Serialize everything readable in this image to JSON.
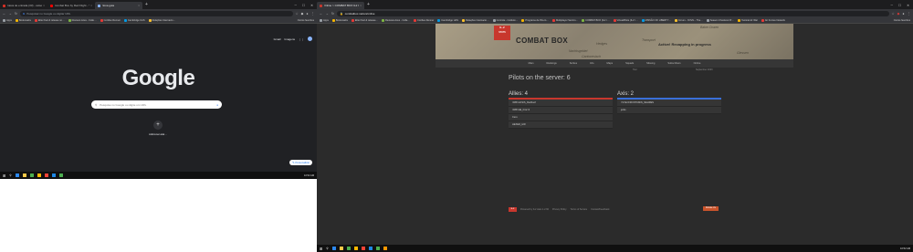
{
  "left": {
    "tabs": [
      {
        "label": "Caixa de entrada (33) - celso.hir…",
        "fav_color": "#d93025",
        "active": false
      },
      {
        "label": "Combat Box by Red Flight - YouT…",
        "fav_color": "#ff0000",
        "active": false
      },
      {
        "label": "Nova guia",
        "fav_color": "#8ab4f8",
        "active": true
      }
    ],
    "address_placeholder": "Pesquisar no Google ou digitar URL",
    "bookmarks": [
      "Apps",
      "Bookmarks",
      "Elite fired & release no…",
      "Reviews Aces - Colle…",
      "Cortões Renner",
      "Cambridge UAS",
      "Relações Internacio…"
    ],
    "bookmarks_right": "Outros favoritos",
    "google_links": [
      "Gmail",
      "Imagens"
    ],
    "logo": "Google",
    "search_placeholder": "Pesquise no Google ou digite um URL",
    "shortcut_label": "Adicionar atal…",
    "customize_label": "Personalizar",
    "time": "10:52 AM",
    "taskbar_colors": [
      "#2d89ef",
      "#f7c948",
      "#4caf50",
      "#ffb900",
      "#f44336",
      "#1e88e5",
      "#4caf50"
    ]
  },
  "right": {
    "tabs": [
      {
        "label": "Online > COMBAT BOX IL2 Grind…",
        "fav_color": "#c8372d",
        "active": true
      }
    ],
    "address": "combatbox.net/en/online",
    "bookmarks": [
      "Apps",
      "Bookmarks",
      "Elite fired & release…",
      "Reviews Aces - Colle…",
      "Cortões Renner",
      "Cambridge UAS",
      "Relações Internacio…",
      "Controle - Instituto…",
      "Programa de Pós-G…",
      "Multiplayer Serviro…",
      "COMBAT BOX (IL2 r…",
      "VirtualPilots (IL2 r…",
      "MISSÃO OF LIBERTY…",
      "Forum - XOVIL - The…",
      "Season Checkout Pr…",
      "Tactical Air War",
      "Air Forces Network"
    ],
    "bookmarks_right": "Outros favoritos",
    "header": {
      "logo_text": "IL-2",
      "logo_sub": "STATS",
      "title": "COMBAT BOX",
      "motto": "Active! Recapping in progress",
      "map_labels": [
        "Hedges",
        "Transport",
        "Nachtsgebiet",
        "Baker Dozen",
        "Cantonesisch",
        "Giessen"
      ]
    },
    "nav": [
      "Main",
      "Rankings",
      "Sorties",
      "Info",
      "Maps",
      "Squads",
      "Missing",
      "Subscribers",
      "Online"
    ],
    "sub": {
      "left": "Tour",
      "right": "September 2023"
    },
    "heading": "Pilots on the server: 6",
    "allies": {
      "title": "Allies: 4",
      "bar_color": "#c8372d",
      "pilots": [
        "=RB=HCSIS_Redhoof",
        "=RB=HE_Fire>3",
        "Ceru",
        "HEXED_HW"
      ]
    },
    "axis": {
      "title": "Axis: 2",
      "bar_color": "#3a6fd8",
      "pilots": [
        "=VVE=FRONTUMIN_NEHRES",
        "jerko"
      ]
    },
    "footer": [
      "Powered by IL2 stats 1.2.60",
      "Privacy Policy",
      "Terms of Service",
      "Contact/Feedback"
    ],
    "footer_logo": "IL-2",
    "footer_button": "Donate Us",
    "time": "10:52 AM",
    "taskbar_colors": [
      "#2d89ef",
      "#f7c948",
      "#4caf50",
      "#ffb900",
      "#f44336",
      "#1e88e5",
      "#4caf50",
      "#ff9800"
    ]
  }
}
